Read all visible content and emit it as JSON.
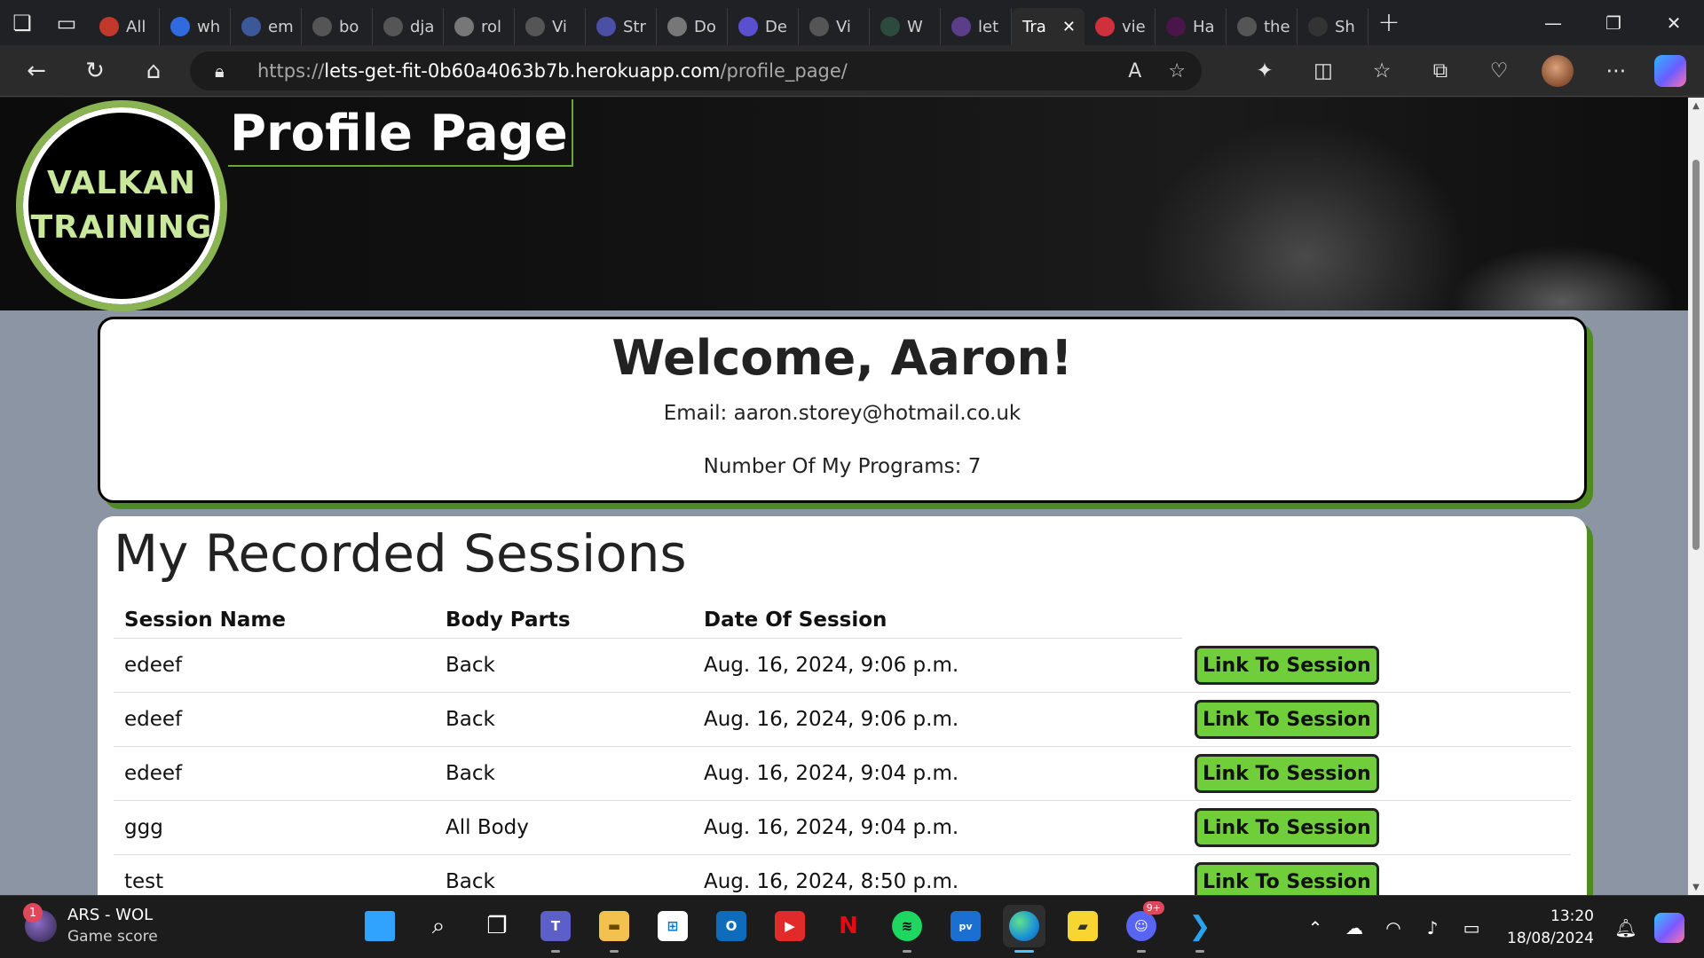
{
  "browser": {
    "tabs": [
      {
        "label": "All",
        "color": "#c0392b"
      },
      {
        "label": "wh",
        "color": "#2f6bde"
      },
      {
        "label": "em",
        "color": "#3b5998"
      },
      {
        "label": "bo",
        "color": "#555555"
      },
      {
        "label": "dja",
        "color": "#555555"
      },
      {
        "label": "rol",
        "color": "#777777"
      },
      {
        "label": "Vi",
        "color": "#555555"
      },
      {
        "label": "Str",
        "color": "#4b4fa6"
      },
      {
        "label": "Do",
        "color": "#777777"
      },
      {
        "label": "De",
        "color": "#5a4fcf"
      },
      {
        "label": "Vi",
        "color": "#555555"
      },
      {
        "label": "W",
        "color": "#2d4a3e"
      },
      {
        "label": "let",
        "color": "#5a3e8a"
      }
    ],
    "active_tab": {
      "label": "Tra"
    },
    "tabs_after": [
      {
        "label": "vie",
        "color": "#d0303c"
      },
      {
        "label": "Ha",
        "color": "#4a154b"
      },
      {
        "label": "the",
        "color": "#555555"
      },
      {
        "label": "Sh",
        "color": "#333333"
      }
    ],
    "url_prefix": "https://",
    "url_host": "lets-get-fit-0b60a4063b7b.herokuapp.com",
    "url_path": "/profile_page/"
  },
  "page": {
    "logo_line1": "VALKAN",
    "logo_line2": "TRAINING",
    "title": "Profile Page",
    "welcome": "Welcome, Aaron!",
    "email_label": "Email:",
    "email": "aaron.storey@hotmail.co.uk",
    "programs_label": "Number Of My Programs:",
    "programs_count": "7",
    "sessions_heading": "My Recorded Sessions",
    "columns": [
      "Session Name",
      "Body Parts",
      "Date Of Session"
    ],
    "link_label": "Link To Session",
    "sessions": [
      {
        "name": "edeef",
        "body": "Back",
        "date": "Aug. 16, 2024, 9:06 p.m."
      },
      {
        "name": "edeef",
        "body": "Back",
        "date": "Aug. 16, 2024, 9:06 p.m."
      },
      {
        "name": "edeef",
        "body": "Back",
        "date": "Aug. 16, 2024, 9:04 p.m."
      },
      {
        "name": "ggg",
        "body": "All Body",
        "date": "Aug. 16, 2024, 9:04 p.m."
      },
      {
        "name": "test",
        "body": "Back",
        "date": "Aug. 16, 2024, 8:50 p.m."
      }
    ]
  },
  "taskbar": {
    "widget_badge": "1",
    "widget_title": "ARS - WOL",
    "widget_sub": "Game score",
    "time": "13:20",
    "date": "18/08/2024",
    "discord_badge": "9+"
  },
  "colors": {
    "accent_green": "#6fce3a",
    "card_shadow": "#4f8a22",
    "logo_ring": "#8ab352"
  }
}
